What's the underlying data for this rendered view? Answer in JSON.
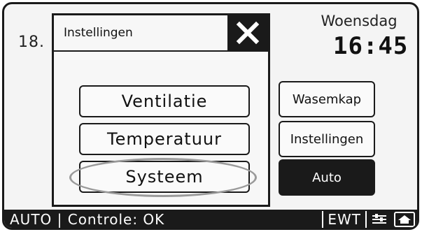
{
  "header": {
    "temperature_partial": "18.",
    "day": "Woensdag",
    "time": "16:45"
  },
  "dialog": {
    "title": "Instellingen",
    "close_icon": "close-icon",
    "menu": [
      {
        "label": "Ventilatie"
      },
      {
        "label": "Temperatuur"
      },
      {
        "label": "Systeem",
        "highlighted": true
      }
    ]
  },
  "side_buttons": [
    {
      "label": "Wasemkap",
      "active": false
    },
    {
      "label": "Instellingen",
      "active": false
    },
    {
      "label": "Auto",
      "active": true
    }
  ],
  "status_bar": {
    "text": "AUTO | Controle: OK",
    "ewt": "EWT",
    "icons": [
      "settings-sliders-icon",
      "home-icon"
    ]
  },
  "colors": {
    "frame": "#1a1a1a",
    "background": "#f4f4f4",
    "highlight_ring": "#9a9a9a"
  }
}
